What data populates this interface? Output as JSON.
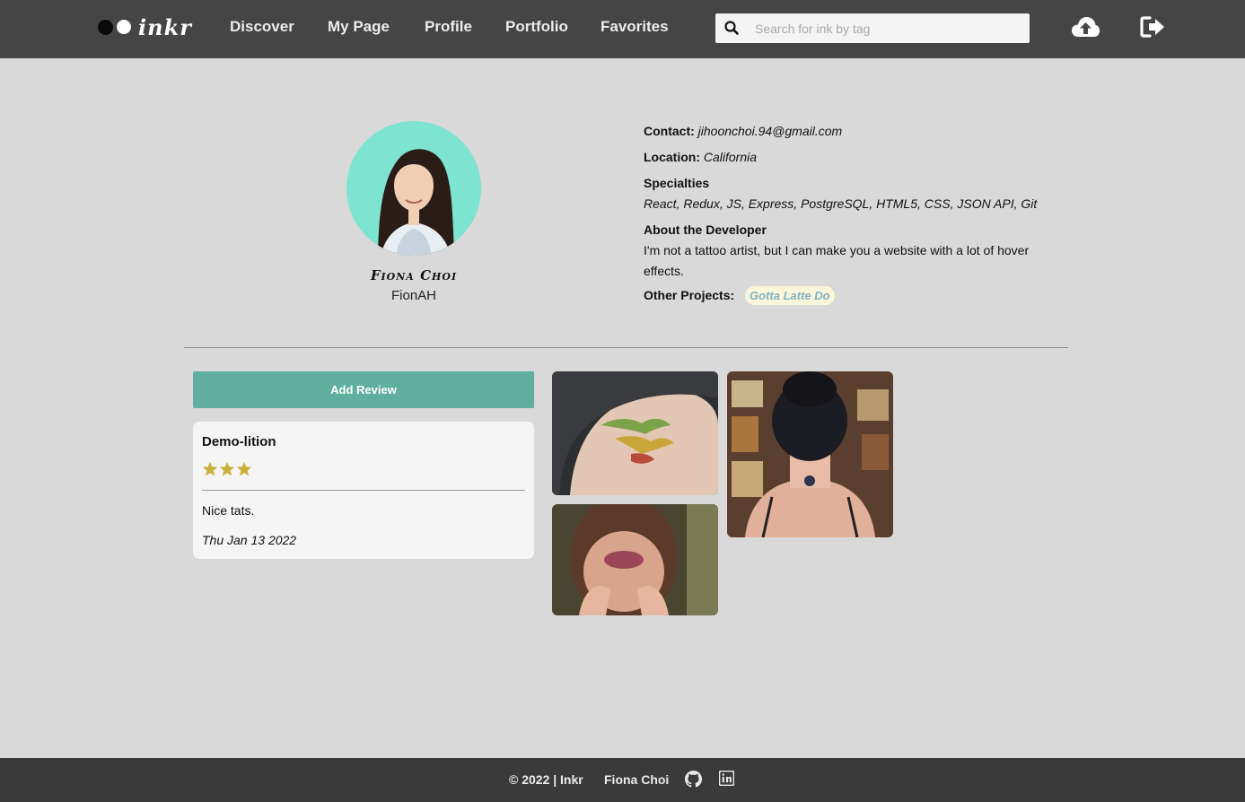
{
  "nav": {
    "logo_text": "inkr",
    "links": [
      "Discover",
      "My Page",
      "Profile",
      "Portfolio",
      "Favorites"
    ],
    "search_placeholder": "Search for ink by tag",
    "icons": [
      "search-icon",
      "upload-cloud-icon",
      "logout-icon"
    ]
  },
  "profile": {
    "name": "Fiona Choi",
    "handle": "FionAH",
    "contact_label": "Contact:",
    "contact_value": "jihoonchoi.94@gmail.com",
    "location_label": "Location:",
    "location_value": "California",
    "specialties_label": "Specialties",
    "specialties_value": "React, Redux, JS, Express, PostgreSQL, HTML5, CSS, JSON API, Git",
    "about_label": "About the Developer",
    "about_line1": "I'm not a tattoo artist, but I can make you a website with a lot of hover",
    "about_line2": "effects.",
    "projects_label": "Other Projects:",
    "project_chip": "Gotta Latte Do"
  },
  "reviews": {
    "add_label": "Add Review",
    "items": [
      {
        "title": "Demo-lition",
        "rating": 3,
        "body": "Nice tats.",
        "date": "Thu Jan 13 2022"
      }
    ]
  },
  "footer": {
    "copyright": "© 2022 | Inkr",
    "author": "Fiona Choi",
    "icons": [
      "github-icon",
      "linkedin-icon"
    ]
  },
  "colors": {
    "nav_bg": "#454545",
    "page_bg": "#d9d9d9",
    "accent": "#5fae9e",
    "star": "#c8b23e",
    "footer_bg": "#3a3a3a"
  }
}
